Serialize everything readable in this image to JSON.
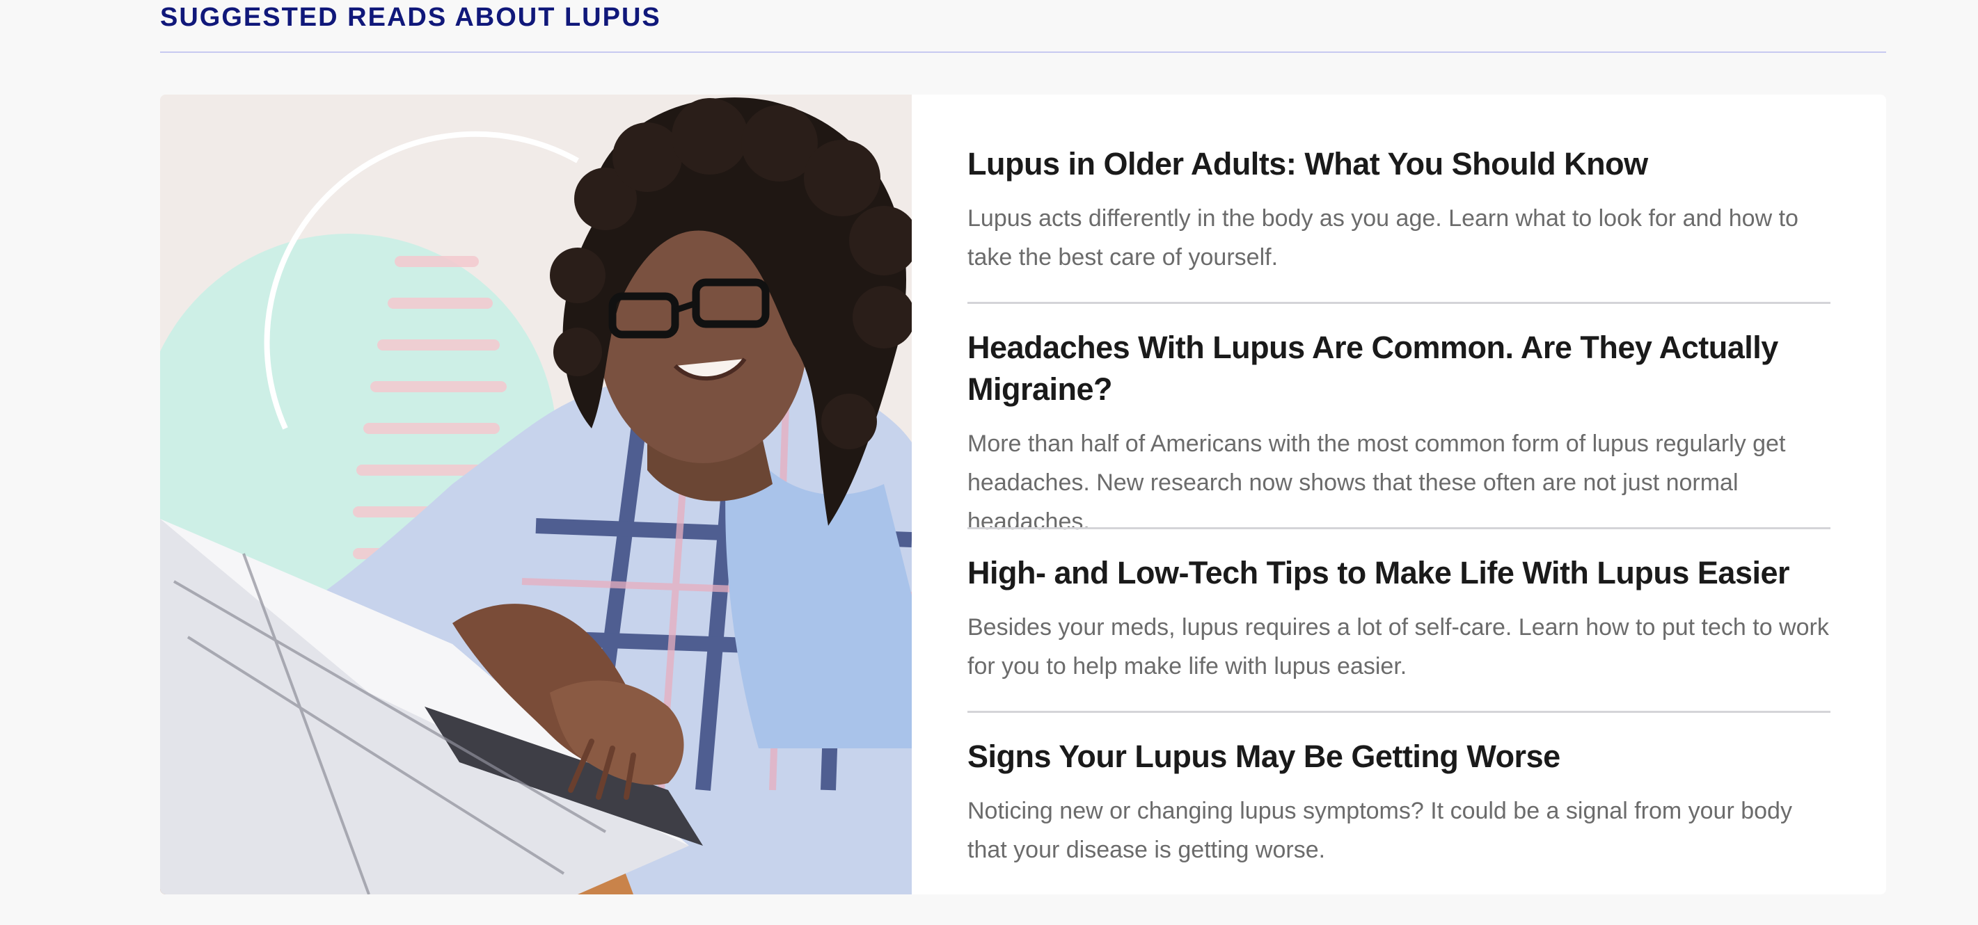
{
  "section": {
    "title": "SUGGESTED READS ABOUT LUPUS"
  },
  "hero_image": {
    "alt": "Woman with glasses smiling while typing on a laptop"
  },
  "reads": [
    {
      "title": "Lupus in Older Adults: What You Should Know",
      "description": "Lupus acts differently in the body as you age. Learn what to look for and how to take the best care of yourself."
    },
    {
      "title": "Headaches With Lupus Are Common. Are They Actually Migraine?",
      "description": "More than half of Americans with the most common form of lupus regularly get headaches. New research now shows that these often are not just normal headaches."
    },
    {
      "title": "High- and Low-Tech Tips to Make Life With Lupus Easier",
      "description": "Besides your meds, lupus requires a lot of self-care. Learn how to put tech to work for you to help make life with lupus easier."
    },
    {
      "title": "Signs Your Lupus May Be Getting Worse",
      "description": "Noticing new or changing lupus symptoms? It could be a signal from your body that your disease is getting worse."
    }
  ],
  "colors": {
    "section_title": "#10187a",
    "title_rule": "#c7c9f0",
    "read_title": "#1a1a1a",
    "read_description": "#6b6b6b",
    "divider": "#d4d4d8",
    "page_background": "#f8f8f8",
    "card_background": "#ffffff"
  }
}
